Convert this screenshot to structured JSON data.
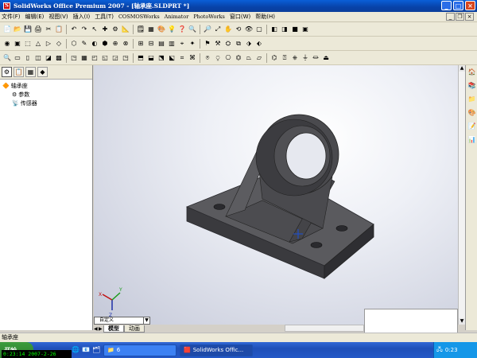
{
  "window": {
    "title": "SolidWorks Office Premium 2007 - [轴承座.SLDPRT *]",
    "min": "_",
    "max": "□",
    "close": "×"
  },
  "menu": [
    "文件(F)",
    "编辑(E)",
    "视图(V)",
    "插入(I)",
    "工具(T)",
    "COSMOSWorks",
    "Animator",
    "PhotoWorks",
    "窗口(W)",
    "帮助(H)"
  ],
  "mdi": {
    "min": "_",
    "restore": "❐",
    "close": "×"
  },
  "toolbar1": [
    "📄",
    "📂",
    "💾",
    "🖨",
    "✂",
    "📋",
    "↶",
    "↷",
    "↖",
    "✚",
    "⚙",
    "📐",
    "🗒",
    "▦",
    "🎨",
    "💡",
    "❓",
    "🔍",
    "🔎",
    "⤢",
    "✋",
    "⟲",
    "👁",
    "▢",
    "◧",
    "◨",
    "■",
    "▣"
  ],
  "toolbar2": [
    "◉",
    "▣",
    "⬚",
    "△",
    "▷",
    "◇",
    "⬡",
    "✎",
    "◐",
    "⬢",
    "⊕",
    "⊗",
    "⊞",
    "⊟",
    "▤",
    "▥",
    "⌖",
    "✦",
    "⚑",
    "⚒",
    "⛭",
    "⧉",
    "⬗",
    "⬖"
  ],
  "toolbar3": [
    "🔍",
    "▭",
    "▯",
    "◫",
    "◪",
    "▩",
    "◳",
    "▦",
    "◰",
    "◱",
    "◲",
    "◳",
    "⬒",
    "⬓",
    "⬔",
    "⬕",
    "⌗",
    "⌘",
    "⍟",
    "⍜",
    "⎔",
    "⏣",
    "⏢",
    "⏥",
    "⌬",
    "⍰",
    "⎈",
    "⏚",
    "⏛",
    "⏏"
  ],
  "panel": {
    "tabs": [
      "⚙",
      "📋",
      "▦",
      "◆"
    ],
    "tree": [
      {
        "label": "轴承座",
        "icon": "🔶"
      },
      {
        "label": "参数",
        "icon": "⚙"
      },
      {
        "label": "传感器",
        "icon": "📡"
      }
    ],
    "view_select": "自定义",
    "dropdown_arrow": "▼"
  },
  "bottom_tabs": {
    "prev": "◀",
    "next": "▶",
    "model": "模型",
    "animation": "动画"
  },
  "viewport": {
    "background": "#e8eaf2",
    "triad": {
      "x": "X",
      "y": "Y",
      "z": "Z"
    }
  },
  "scrollbar": {
    "up": "▲",
    "down": "▼"
  },
  "taskpane": [
    "🏠",
    "📚",
    "📁",
    "🎨",
    "📝",
    "📊"
  ],
  "status": "轴承座",
  "taskbar": {
    "start": "开始",
    "clock_overlay": "0:23:14 2007-2-26",
    "quicklaunch": [
      "🌐",
      "📧",
      "🗂"
    ],
    "tasks": [
      {
        "label": "6",
        "icon": "📁",
        "active": false
      },
      {
        "label": "SolidWorks Offic...",
        "icon": "🟥",
        "active": true
      }
    ],
    "tray_time": "0:23"
  }
}
